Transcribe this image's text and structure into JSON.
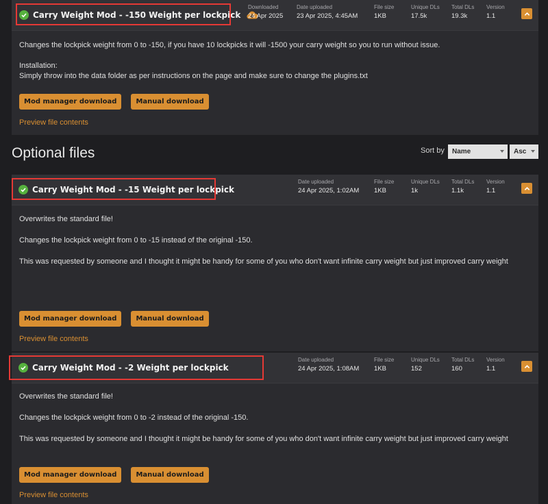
{
  "colors": {
    "accent": "#d98f32",
    "check": "#56b13e",
    "highlight": "#e53935",
    "card_bg": "#2b2b2f",
    "header_bg": "#323236"
  },
  "main_file": {
    "title": "Carry Weight Mod - -150 Weight per lockpick",
    "stats": [
      {
        "label": "Downloaded",
        "value": "24 Apr 2025"
      },
      {
        "label": "Date uploaded",
        "value": "23 Apr 2025, 4:45AM"
      },
      {
        "label": "File size",
        "value": "1KB"
      },
      {
        "label": "Unique DLs",
        "value": "17.5k"
      },
      {
        "label": "Total DLs",
        "value": "19.3k"
      },
      {
        "label": "Version",
        "value": "1.1"
      }
    ],
    "description": [
      "Changes the lockpick weight from 0 to -150, if you have 10 lockpicks it will -1500 your carry weight so you to run without issue.",
      "Installation:",
      "Simply throw into the data folder as per instructions on the page and make sure to change the plugins.txt"
    ],
    "mod_manager_label": "Mod manager download",
    "manual_label": "Manual download",
    "preview_label": "Preview file contents"
  },
  "optional": {
    "heading": "Optional files",
    "sort_label": "Sort by",
    "sort_field": "Name",
    "sort_order": "Asc"
  },
  "optional_files": [
    {
      "title": "Carry Weight Mod - -15 Weight per lockpick",
      "stats": [
        {
          "label": "Date uploaded",
          "value": "24 Apr 2025, 1:02AM"
        },
        {
          "label": "File size",
          "value": "1KB"
        },
        {
          "label": "Unique DLs",
          "value": "1k"
        },
        {
          "label": "Total DLs",
          "value": "1.1k"
        },
        {
          "label": "Version",
          "value": "1.1"
        }
      ],
      "description": [
        "Overwrites the standard file!",
        "Changes the lockpick weight from 0 to -15 instead of the original -150.",
        "This was requested by someone and I thought it might be handy for some of you who don't want infinite carry weight but just improved carry weight"
      ],
      "mod_manager_label": "Mod manager download",
      "manual_label": "Manual download",
      "preview_label": "Preview file contents"
    },
    {
      "title": "Carry Weight Mod - -2 Weight per lockpick",
      "stats": [
        {
          "label": "Date uploaded",
          "value": "24 Apr 2025, 1:08AM"
        },
        {
          "label": "File size",
          "value": "1KB"
        },
        {
          "label": "Unique DLs",
          "value": "152"
        },
        {
          "label": "Total DLs",
          "value": "160"
        },
        {
          "label": "Version",
          "value": "1.1"
        }
      ],
      "description": [
        "Overwrites the standard file!",
        "Changes the lockpick weight from 0 to -2 instead of the original -150.",
        "This was requested by someone and I thought it might be handy for some of you who don't want infinite carry weight but just improved carry weight"
      ],
      "mod_manager_label": "Mod manager download",
      "manual_label": "Manual download",
      "preview_label": "Preview file contents"
    }
  ]
}
